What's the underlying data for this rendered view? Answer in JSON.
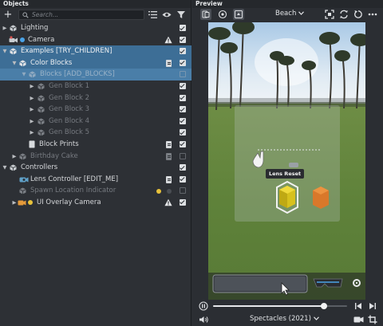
{
  "objects_panel": {
    "title": "Objects",
    "search_placeholder": "Search...",
    "items": [
      {
        "label": "Lighting"
      },
      {
        "label": "Camera"
      },
      {
        "label": "Examples [TRY_CHILDREN]"
      },
      {
        "label": "Color Blocks"
      },
      {
        "label": "Blocks [ADD_BLOCKS]"
      },
      {
        "label": "Gen Block 1"
      },
      {
        "label": "Gen Block 2"
      },
      {
        "label": "Gen Block 3"
      },
      {
        "label": "Gen Block 4"
      },
      {
        "label": "Gen Block 5"
      },
      {
        "label": "Block Prints"
      },
      {
        "label": "Birthday Cake"
      },
      {
        "label": "Controllers"
      },
      {
        "label": "Lens Controller [EDIT_ME]"
      },
      {
        "label": "Spawn Location Indicator"
      },
      {
        "label": "UI Overlay Camera"
      }
    ]
  },
  "preview_panel": {
    "title": "Preview",
    "scene_select": "Beach",
    "lens_reset_label": "Lens Reset",
    "device_select": "Spectacles (2021)",
    "playback_progress": 0.83
  },
  "colors": {
    "selection": "#3d6e96",
    "accent_blue": "#4aa3e8",
    "warning_yellow": "#e8c23b"
  }
}
